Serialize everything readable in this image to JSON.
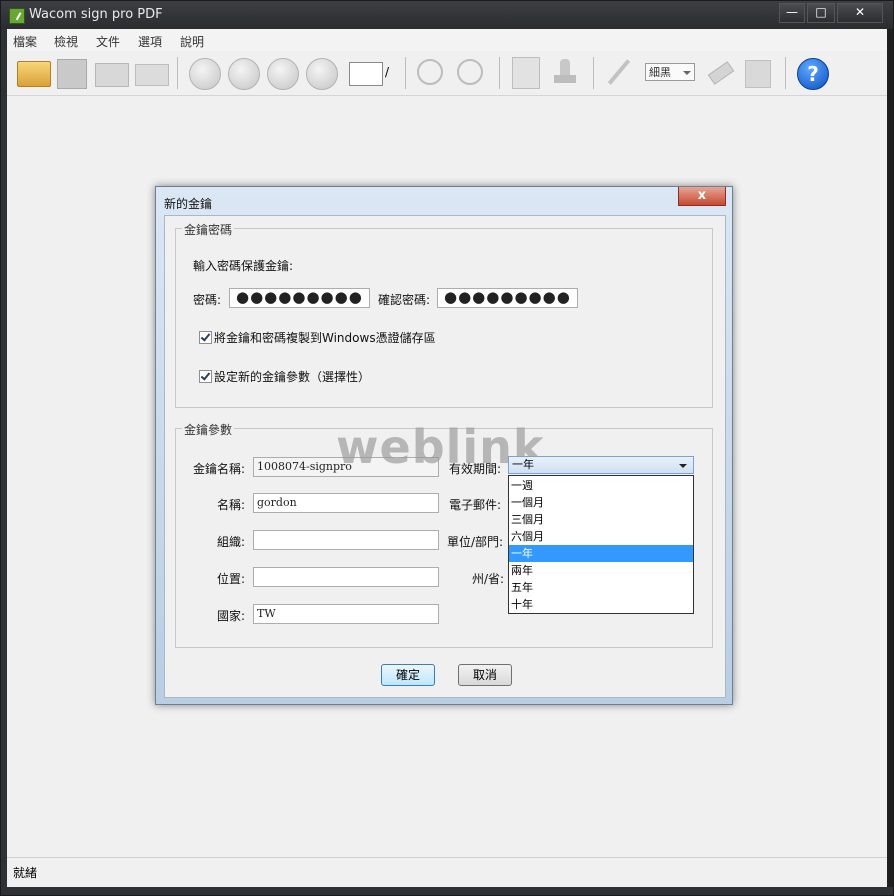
{
  "window": {
    "title": "Wacom sign pro PDF",
    "minimize": "—",
    "maximize": "□",
    "close": "✕"
  },
  "menu": [
    "檔案",
    "檢視",
    "文件",
    "選項",
    "說明"
  ],
  "toolbar": {
    "page_separator": "/",
    "pen_color": "細黑",
    "help_label": "?"
  },
  "status": {
    "text": "就緒"
  },
  "dialog": {
    "title": "新的金鑰",
    "close_label": "x",
    "password_group": {
      "legend": "金鑰密碼",
      "instruction": "輸入密碼保護金鑰:",
      "password_label": "密碼:",
      "password_value": "●●●●●●●●●",
      "confirm_label": "確認密碼:",
      "confirm_value": "●●●●●●●●●",
      "copy_to_store_label": "將金鑰和密碼複製到Windows憑證儲存區",
      "copy_to_store_checked": true,
      "set_params_label": "設定新的金鑰參數（選擇性）",
      "set_params_checked": true
    },
    "params_group": {
      "legend": "金鑰參數",
      "key_name_label": "金鑰名稱:",
      "key_name_value": "1008074-signpro",
      "name_label": "名稱:",
      "name_value": "gordon",
      "org_label": "組織:",
      "org_value": "",
      "location_label": "位置:",
      "location_value": "",
      "country_label": "國家:",
      "country_value": "TW",
      "validity_label": "有效期間:",
      "validity_value": "一年",
      "email_label": "電子郵件:",
      "unit_label": "單位/部門:",
      "state_label": "州/省:",
      "validity_options": [
        "一週",
        "一個月",
        "三個月",
        "六個月",
        "一年",
        "兩年",
        "五年",
        "十年"
      ],
      "selected_index": 4
    },
    "ok_label": "確定",
    "cancel_label": "取消"
  },
  "watermark": "weblink"
}
